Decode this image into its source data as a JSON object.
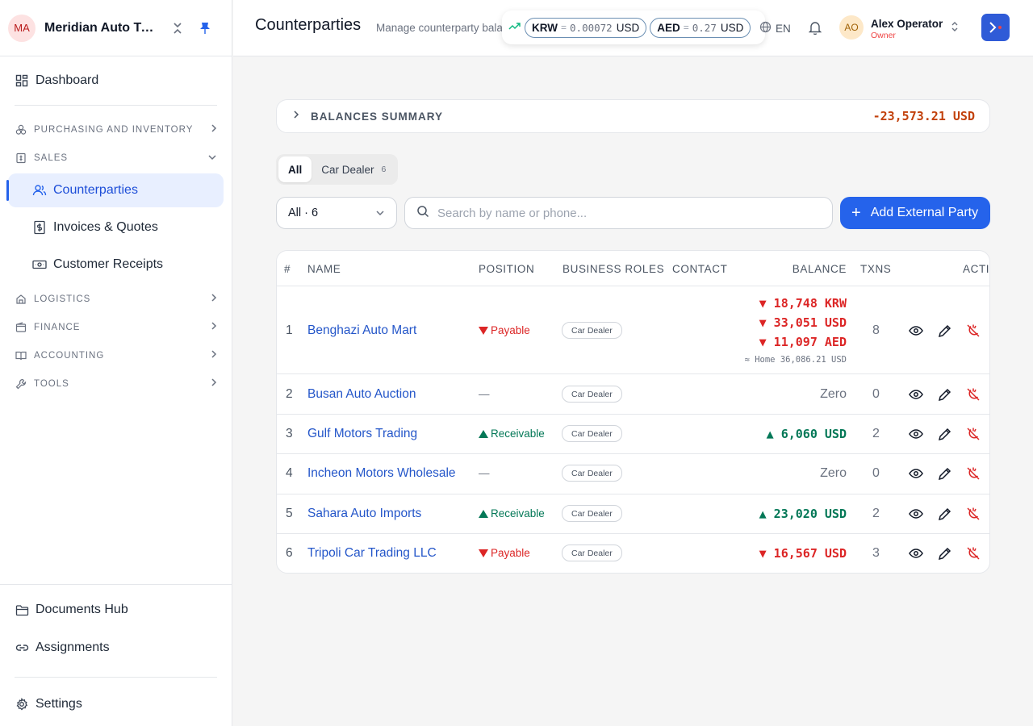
{
  "sidebar": {
    "org_initials": "MA",
    "org_name": "Meridian Auto Trading",
    "dashboard": "Dashboard",
    "sections": [
      {
        "label": "PURCHASING AND INVENTORY"
      },
      {
        "label": "SALES"
      },
      {
        "label": "LOGISTICS"
      },
      {
        "label": "FINANCE"
      },
      {
        "label": "ACCOUNTING"
      },
      {
        "label": "TOOLS"
      }
    ],
    "sales_items": [
      {
        "label": "Counterparties"
      },
      {
        "label": "Invoices & Quotes"
      },
      {
        "label": "Customer Receipts"
      }
    ],
    "documents_hub": "Documents Hub",
    "assignments": "Assignments",
    "settings": "Settings"
  },
  "header": {
    "title": "Counterparties",
    "subtitle": "Manage counterparty balances",
    "rates": [
      {
        "currency": "KRW",
        "eq": "=",
        "value": "0.00072",
        "unit": "USD"
      },
      {
        "currency": "AED",
        "eq": "=",
        "value": "0.27",
        "unit": "USD"
      }
    ],
    "language": "EN",
    "user": {
      "initials": "AO",
      "name": "Alex Operator",
      "role": "Owner"
    }
  },
  "summary": {
    "label": "BALANCES SUMMARY",
    "amount": "-23,573.21 USD"
  },
  "tabs": [
    {
      "label": "All",
      "count": ""
    },
    {
      "label": "Car Dealer",
      "count": "6"
    }
  ],
  "filter": {
    "value": "All · 6"
  },
  "search": {
    "placeholder": "Search by name or phone..."
  },
  "add_button": "Add External Party",
  "table": {
    "columns": {
      "num": "#",
      "name": "NAME",
      "position": "POSITION",
      "roles": "BUSINESS ROLES",
      "contact": "CONTACT",
      "balance": "BALANCE",
      "txns": "TXNS",
      "actions": "ACTIONS"
    },
    "rows": [
      {
        "num": "1",
        "name": "Benghazi Auto Mart",
        "position": "Payable",
        "role": "Car Dealer",
        "balances": [
          "▼ 18,748 KRW",
          "▼ 33,051 USD",
          "▼ 11,097 AED"
        ],
        "home": "≈ Home 36,086.21 USD",
        "txns": "8"
      },
      {
        "num": "2",
        "name": "Busan Auto Auction",
        "position": "—",
        "role": "Car Dealer",
        "balance": "Zero",
        "txns": "0"
      },
      {
        "num": "3",
        "name": "Gulf Motors Trading",
        "position": "Receivable",
        "role": "Car Dealer",
        "balance": "▲ 6,060 USD",
        "txns": "2"
      },
      {
        "num": "4",
        "name": "Incheon Motors Wholesale",
        "position": "—",
        "role": "Car Dealer",
        "balance": "Zero",
        "txns": "0"
      },
      {
        "num": "5",
        "name": "Sahara Auto Imports",
        "position": "Receivable",
        "role": "Car Dealer",
        "balance": "▲ 23,020 USD",
        "txns": "2"
      },
      {
        "num": "6",
        "name": "Tripoli Car Trading LLC",
        "position": "Payable",
        "role": "Car Dealer",
        "balance": "▼ 16,567 USD",
        "txns": "3"
      }
    ]
  }
}
